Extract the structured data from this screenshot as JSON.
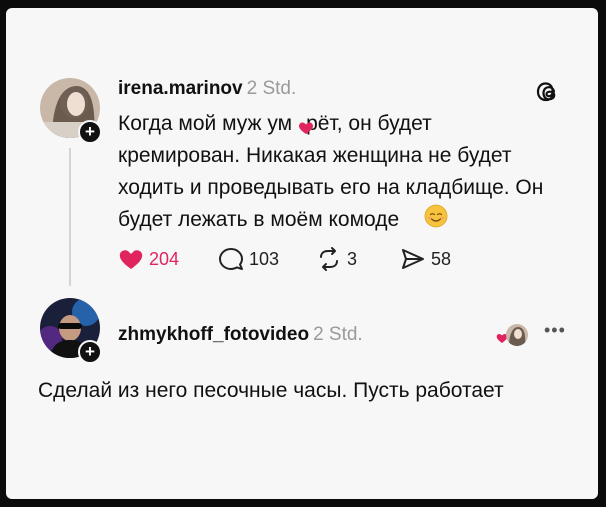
{
  "post": {
    "username": "irena.marinov",
    "time": "2 Std.",
    "text_line1_a": "Когда мой муж ум",
    "text_line1_b": "рёт, он будет",
    "text_rest": "кремирован. Никакая женщина не будет ходить и проведывать его на кладбище. Он будет лежать в моём комоде",
    "likes": "204",
    "comments": "103",
    "reposts": "3",
    "shares": "58"
  },
  "reply": {
    "username": "zhmykhoff_fotovideo",
    "time": "2 Std.",
    "text": "Сделай из него песочные часы. Пусть работает"
  },
  "icons": {
    "like": "heart-filled-icon",
    "comment": "comment-bubble-icon",
    "repost": "repost-icon",
    "share": "send-icon",
    "brand": "threads-logo-icon",
    "more": "more-dots-icon"
  },
  "colors": {
    "like_red": "#e0245e",
    "text": "#111111",
    "muted": "#9a9a9a"
  }
}
